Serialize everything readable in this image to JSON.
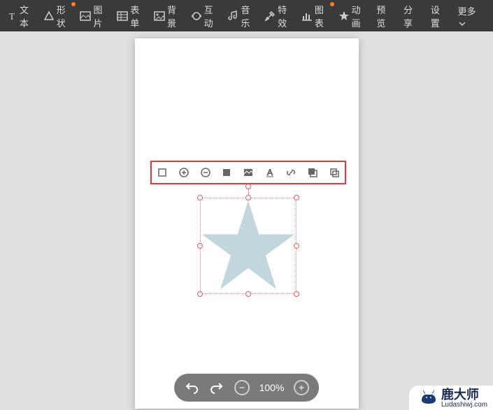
{
  "toolbar": {
    "text": {
      "label": "文本",
      "icon": "text-icon"
    },
    "shape": {
      "label": "形状",
      "icon": "shape-icon",
      "dot": true
    },
    "image": {
      "label": "图片",
      "icon": "image-icon"
    },
    "form": {
      "label": "表单",
      "icon": "form-icon"
    },
    "bg": {
      "label": "背景",
      "icon": "bg-icon"
    },
    "inter": {
      "label": "互动",
      "icon": "inter-icon"
    },
    "music": {
      "label": "音乐",
      "icon": "music-icon"
    },
    "fx": {
      "label": "特效",
      "icon": "fx-icon"
    },
    "chart": {
      "label": "图表",
      "icon": "chart-icon",
      "dot": true
    },
    "anim": {
      "label": "动画",
      "icon": "anim-icon"
    },
    "preview": {
      "label": "预览"
    },
    "share": {
      "label": "分享"
    },
    "settings": {
      "label": "设置"
    },
    "more": {
      "label": "更多"
    }
  },
  "floatToolbar": {
    "items": [
      {
        "name": "crop-icon"
      },
      {
        "name": "zoom-in-icon"
      },
      {
        "name": "zoom-out-icon"
      },
      {
        "name": "fill-icon"
      },
      {
        "name": "image-icon"
      },
      {
        "name": "text-style-icon"
      },
      {
        "name": "link-icon"
      },
      {
        "name": "layer-icon"
      },
      {
        "name": "copy-icon"
      }
    ]
  },
  "zoom": {
    "level": "100%"
  },
  "shape": {
    "type": "star",
    "fill": "#c2d7dd"
  },
  "watermark": {
    "title": "鹿大师",
    "url": "Ludashiwj.com"
  }
}
